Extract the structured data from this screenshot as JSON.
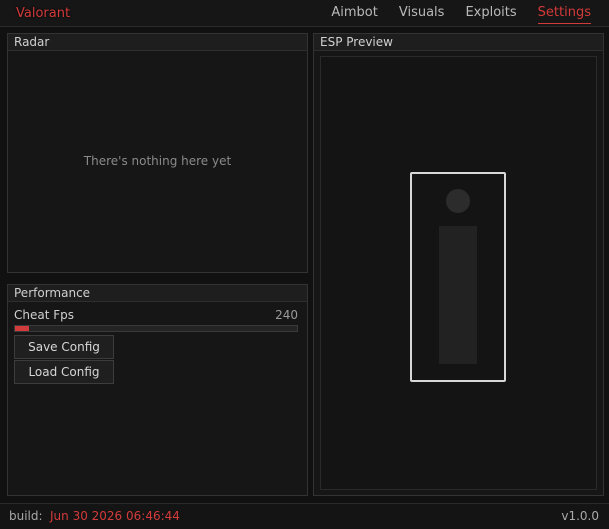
{
  "header": {
    "brand": "Valorant",
    "tabs": [
      {
        "label": "Aimbot",
        "active": false
      },
      {
        "label": "Visuals",
        "active": false
      },
      {
        "label": "Exploits",
        "active": false
      },
      {
        "label": "Settings",
        "active": true
      }
    ]
  },
  "radar": {
    "title": "Radar",
    "empty_message": "There's nothing here yet"
  },
  "performance": {
    "title": "Performance",
    "cheat_fps_label": "Cheat Fps",
    "cheat_fps_value": "240",
    "cheat_fps_fill_fraction": 0.05,
    "save_label": "Save Config",
    "load_label": "Load Config"
  },
  "esp": {
    "title": "ESP Preview"
  },
  "footer": {
    "build_label": "build:",
    "build_date": "Jun 30 2026 06:46:44",
    "version": "v1.0.0"
  },
  "colors": {
    "accent": "#d33a3a",
    "background": "#111111",
    "panel": "#161616"
  }
}
